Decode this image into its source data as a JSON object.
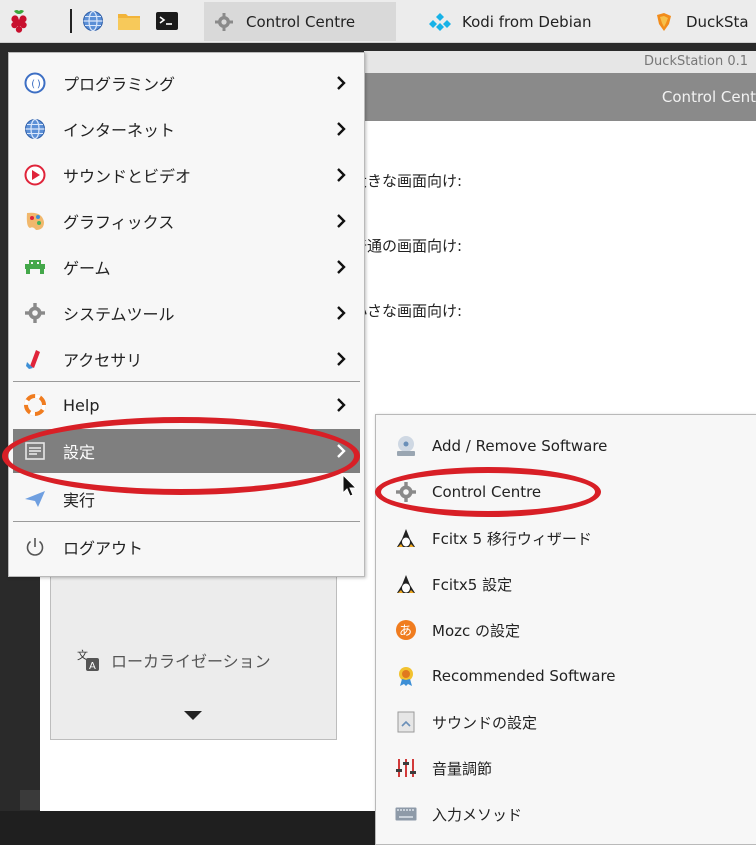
{
  "taskbar": {
    "tasks": [
      {
        "label": "Control Centre",
        "active": true
      },
      {
        "label": "Kodi from Debian",
        "active": false
      },
      {
        "label": "DuckSta",
        "active": false
      }
    ]
  },
  "background_window": {
    "title": "DuckStation 0.1",
    "header": "Control Cent",
    "labels": [
      "大きな画面向け:",
      "普通の画面向け:",
      "小さな画面向け:"
    ],
    "localization_label": "ローカライゼーション"
  },
  "main_menu": {
    "items": [
      {
        "label": "プログラミング",
        "icon": "programming-icon",
        "has_submenu": true
      },
      {
        "label": "インターネット",
        "icon": "internet-globe-icon",
        "has_submenu": true
      },
      {
        "label": "サウンドとビデオ",
        "icon": "sound-video-icon",
        "has_submenu": true
      },
      {
        "label": "グラフィックス",
        "icon": "graphics-icon",
        "has_submenu": true
      },
      {
        "label": "ゲーム",
        "icon": "games-icon",
        "has_submenu": true
      },
      {
        "label": "システムツール",
        "icon": "system-tools-icon",
        "has_submenu": true
      },
      {
        "label": "アクセサリ",
        "icon": "accessories-icon",
        "has_submenu": true
      },
      {
        "label": "Help",
        "icon": "help-lifebuoy-icon",
        "has_submenu": true
      },
      {
        "label": "設定",
        "icon": "settings-icon",
        "has_submenu": true,
        "selected": true
      },
      {
        "label": "実行",
        "icon": "run-icon",
        "has_submenu": false
      },
      {
        "label": "ログアウト",
        "icon": "logout-icon",
        "has_submenu": false
      }
    ]
  },
  "settings_submenu": {
    "items": [
      {
        "label": "Add / Remove Software",
        "icon": "add-remove-software-icon"
      },
      {
        "label": "Control Centre",
        "icon": "control-centre-gear-icon"
      },
      {
        "label": "Fcitx 5 移行ウィザード",
        "icon": "fcitx-penguin-icon"
      },
      {
        "label": "Fcitx5 設定",
        "icon": "fcitx-penguin-icon"
      },
      {
        "label": "Mozc の設定",
        "icon": "mozc-icon"
      },
      {
        "label": "Recommended Software",
        "icon": "recommended-software-icon"
      },
      {
        "label": "サウンドの設定",
        "icon": "sound-settings-icon"
      },
      {
        "label": "音量調節",
        "icon": "volume-mixer-icon"
      },
      {
        "label": "入力メソッド",
        "icon": "keyboard-icon"
      }
    ]
  },
  "colors": {
    "annotation_red": "#d81f26",
    "menu_selected": "#7f7f7f",
    "menu_bg": "#f7f7f7"
  }
}
